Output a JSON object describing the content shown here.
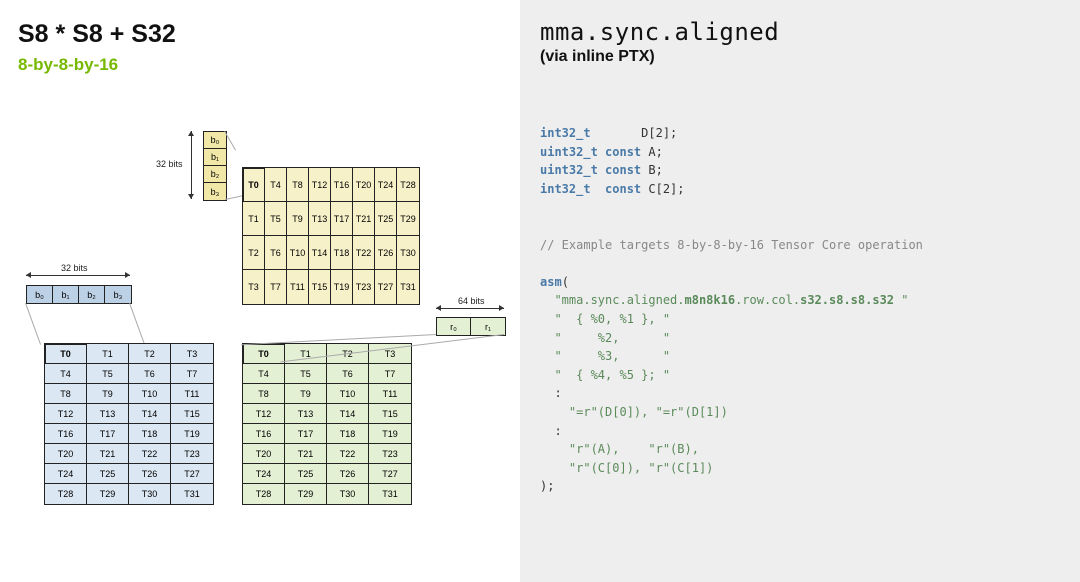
{
  "left": {
    "title": "S8 * S8 + S32",
    "subtitle": "8-by-8-by-16",
    "label_32bits_h": "32 bits",
    "label_32bits_v": "32 bits",
    "label_64bits": "64 bits",
    "blue_bytes": [
      "b₀",
      "b₁",
      "b₂",
      "b₃"
    ],
    "yellow_bytes": [
      "b₀",
      "b₁",
      "b₂",
      "b₃"
    ],
    "green_regs": [
      "r₀",
      "r₁"
    ],
    "yellow_grid": [
      [
        "T0",
        "T4",
        "T8",
        "T12",
        "T16",
        "T20",
        "T24",
        "T28"
      ],
      [
        "T1",
        "T5",
        "T9",
        "T13",
        "T17",
        "T21",
        "T25",
        "T29"
      ],
      [
        "T2",
        "T6",
        "T10",
        "T14",
        "T18",
        "T22",
        "T26",
        "T30"
      ],
      [
        "T3",
        "T7",
        "T11",
        "T15",
        "T19",
        "T23",
        "T27",
        "T31"
      ]
    ],
    "thread_grid": [
      [
        "T0",
        "T1",
        "T2",
        "T3"
      ],
      [
        "T4",
        "T5",
        "T6",
        "T7"
      ],
      [
        "T8",
        "T9",
        "T10",
        "T11"
      ],
      [
        "T12",
        "T13",
        "T14",
        "T15"
      ],
      [
        "T16",
        "T17",
        "T18",
        "T19"
      ],
      [
        "T20",
        "T21",
        "T22",
        "T23"
      ],
      [
        "T24",
        "T25",
        "T26",
        "T27"
      ],
      [
        "T28",
        "T29",
        "T30",
        "T31"
      ]
    ]
  },
  "right": {
    "title": "mma.sync.aligned",
    "subtitle": "(via inline PTX)",
    "decl": {
      "l1_type": "int32_t",
      "l1_rest": "       D[2];",
      "l2_type": "uint32_t const",
      "l2_rest": " A;",
      "l3_type": "uint32_t const",
      "l3_rest": " B;",
      "l4_type": "int32_t  const",
      "l4_rest": " C[2];"
    },
    "comment": "// Example targets 8-by-8-by-16 Tensor Core operation",
    "asm": {
      "kw": "asm",
      "open": "(",
      "s1a": "\"mma.sync.aligned.",
      "s1b": "m8n8k16",
      "s1c": ".row.col.",
      "s1d": "s32.s8.s8.s32",
      "s1e": " \"",
      "s2": "\"  { %0, %1 }, \"",
      "s3": "\"     %2,      \"",
      "s4": "\"     %3,      \"",
      "s5": "\"  { %4, %5 }; \"",
      "colon": ":",
      "out1": "\"=r\"(D[0]), \"=r\"(D[1])",
      "in1": "\"r\"(A),    \"r\"(B),",
      "in2": "\"r\"(C[0]), \"r\"(C[1])",
      "close": ");"
    }
  }
}
